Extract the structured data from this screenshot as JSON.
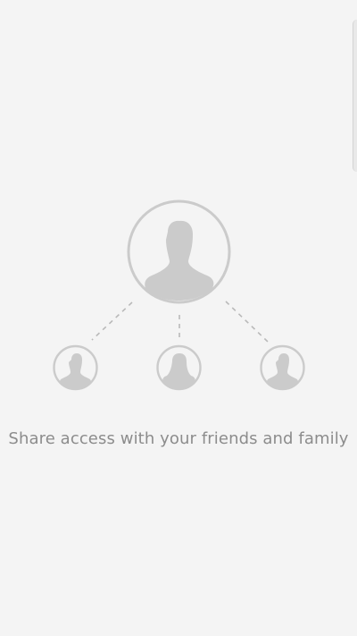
{
  "onboarding": {
    "caption": "Share access with your friends and family"
  },
  "colors": {
    "background": "#f4f4f4",
    "avatar": "#cbcbcb",
    "text": "#8c8c8c"
  },
  "icons": {
    "owner": "male-user-icon",
    "guests": [
      "male-user-icon",
      "female-user-icon",
      "male-user-icon"
    ]
  }
}
